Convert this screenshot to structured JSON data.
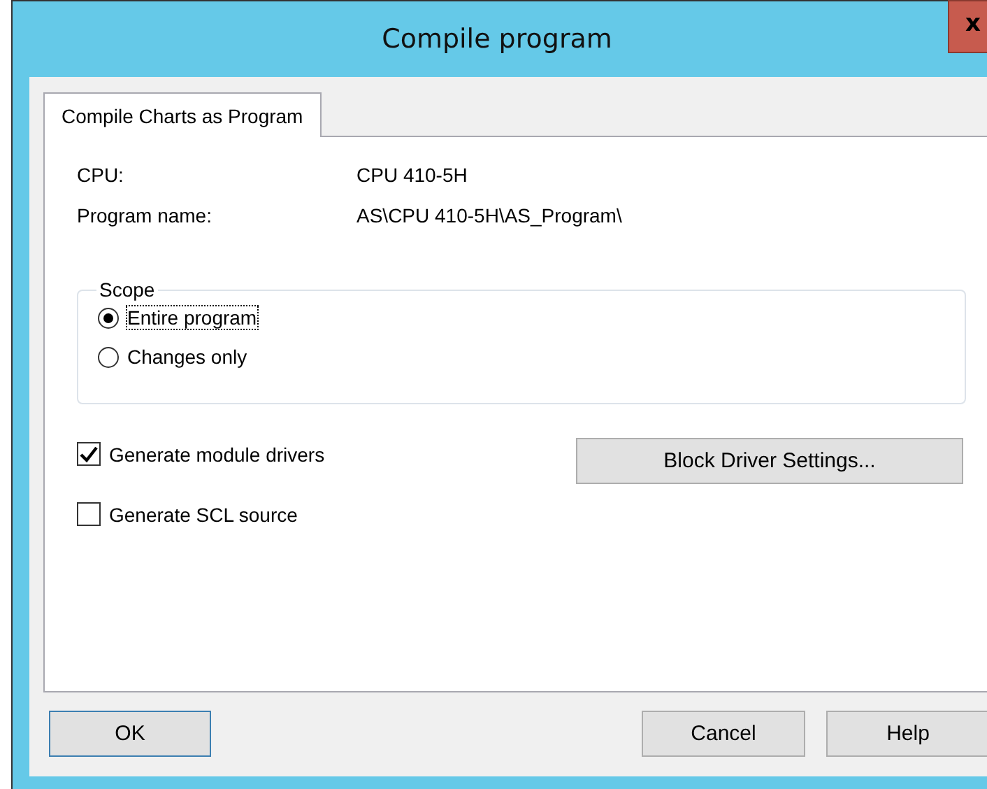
{
  "window": {
    "title": "Compile program",
    "close": "x"
  },
  "tabs": [
    {
      "label": "Compile Charts as Program",
      "selected": true
    }
  ],
  "info": [
    {
      "label": "CPU:",
      "value": "CPU 410-5H"
    },
    {
      "label": "Program name:",
      "value": "AS\\CPU 410-5H\\AS_Program\\"
    }
  ],
  "scope": {
    "legend": "Scope",
    "options": [
      {
        "label": "Entire program",
        "selected": true
      },
      {
        "label": "Changes only",
        "selected": false
      }
    ]
  },
  "options": [
    {
      "label": "Generate module drivers",
      "checked": true
    },
    {
      "label": "Generate SCL source",
      "checked": false
    }
  ],
  "driver_button": "Block Driver Settings...",
  "buttons": [
    {
      "label": "OK",
      "default": true
    },
    {
      "label": "Cancel",
      "default": false
    },
    {
      "label": "Help",
      "default": false
    }
  ]
}
